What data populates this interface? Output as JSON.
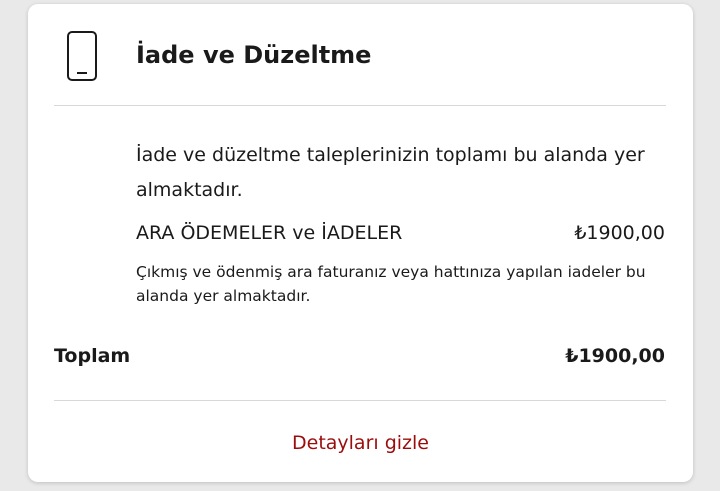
{
  "card": {
    "icon": "mobile-phone-icon",
    "title": "İade ve Düzeltme",
    "description": "İade ve düzeltme taleplerinizin toplamı bu alanda yer almaktadır.",
    "line_item": {
      "label": "ARA ÖDEMELER ve İADELER",
      "amount": "₺1900,00",
      "note": "Çıkmış ve ödenmiş ara faturanız veya hattınıza yapılan iadeler bu alanda yer almaktadır."
    },
    "total": {
      "label": "Toplam",
      "amount": "₺1900,00"
    },
    "toggle_label": "Detayları gizle",
    "colors": {
      "link": "#9b0d0d",
      "divider": "#d8d8d8"
    }
  }
}
